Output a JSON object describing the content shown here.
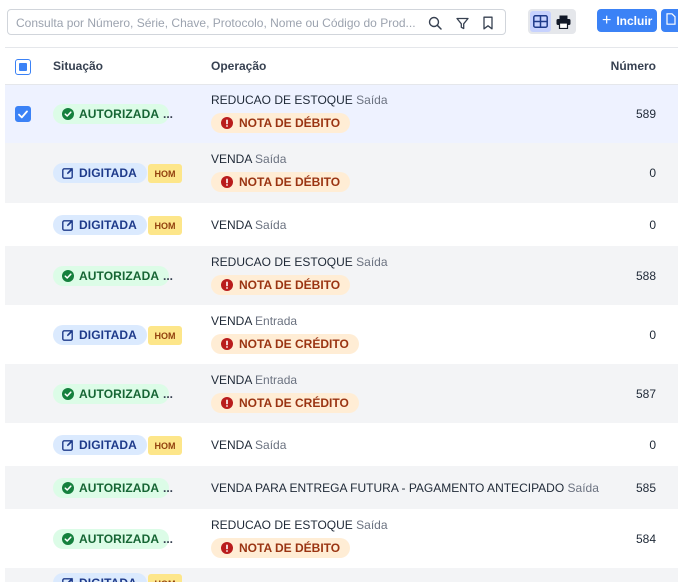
{
  "search": {
    "placeholder": "Consulta por Número, Série, Chave, Protocolo, Nome ou Código do Prod..."
  },
  "toolbar": {
    "add_label": "Incluir",
    "icons": [
      "search-icon",
      "filter-icon",
      "bookmark-icon",
      "grid-view-icon",
      "print-icon",
      "plus-icon",
      "document-icon"
    ]
  },
  "colors": {
    "accent": "#3b82f6",
    "autorizada_bg": "#dcfce7",
    "autorizada_text": "#166534",
    "digitada_bg": "#dbeafe",
    "digitada_text": "#1e3a8a",
    "nota_bg": "#ffedd5",
    "nota_text": "#9a3412",
    "hom_bg": "#fde68a",
    "selected_row": "#eef2ff"
  },
  "table": {
    "headers": {
      "situacao": "Situação",
      "operacao": "Operação",
      "numero": "Número"
    },
    "rows": [
      {
        "status": "AUTORIZADA",
        "status_type": "autorizada",
        "extra": "...",
        "operacao": "REDUCAO DE ESTOQUE",
        "tipo": "Saída",
        "nota": "NOTA DE DÉBITO",
        "numero": "589",
        "selected": true
      },
      {
        "status": "DIGITADA",
        "status_type": "digitada",
        "extra": "HOM",
        "operacao": "VENDA",
        "tipo": "Saída",
        "nota": "NOTA DE DÉBITO",
        "numero": "0",
        "selected": false
      },
      {
        "status": "DIGITADA",
        "status_type": "digitada",
        "extra": "HOM",
        "operacao": "VENDA",
        "tipo": "Saída",
        "nota": "",
        "numero": "0",
        "selected": false
      },
      {
        "status": "AUTORIZADA",
        "status_type": "autorizada",
        "extra": "...",
        "operacao": "REDUCAO DE ESTOQUE",
        "tipo": "Saída",
        "nota": "NOTA DE DÉBITO",
        "numero": "588",
        "selected": false
      },
      {
        "status": "DIGITADA",
        "status_type": "digitada",
        "extra": "HOM",
        "operacao": "VENDA",
        "tipo": "Entrada",
        "nota": "NOTA DE CRÉDITO",
        "numero": "0",
        "selected": false
      },
      {
        "status": "AUTORIZADA",
        "status_type": "autorizada",
        "extra": "...",
        "operacao": "VENDA",
        "tipo": "Entrada",
        "nota": "NOTA DE CRÉDITO",
        "numero": "587",
        "selected": false
      },
      {
        "status": "DIGITADA",
        "status_type": "digitada",
        "extra": "HOM",
        "operacao": "VENDA",
        "tipo": "Saída",
        "nota": "",
        "numero": "0",
        "selected": false
      },
      {
        "status": "AUTORIZADA",
        "status_type": "autorizada",
        "extra": "...",
        "operacao": "VENDA PARA ENTREGA FUTURA - PAGAMENTO ANTECIPADO",
        "tipo": "Saída",
        "nota": "",
        "numero": "585",
        "selected": false
      },
      {
        "status": "AUTORIZADA",
        "status_type": "autorizada",
        "extra": "...",
        "operacao": "REDUCAO DE ESTOQUE",
        "tipo": "Saída",
        "nota": "NOTA DE DÉBITO",
        "numero": "584",
        "selected": false
      },
      {
        "status": "DIGITADA",
        "status_type": "digitada",
        "extra": "HOM",
        "operacao": "",
        "tipo": "",
        "nota": "",
        "numero": "",
        "selected": false
      }
    ]
  }
}
